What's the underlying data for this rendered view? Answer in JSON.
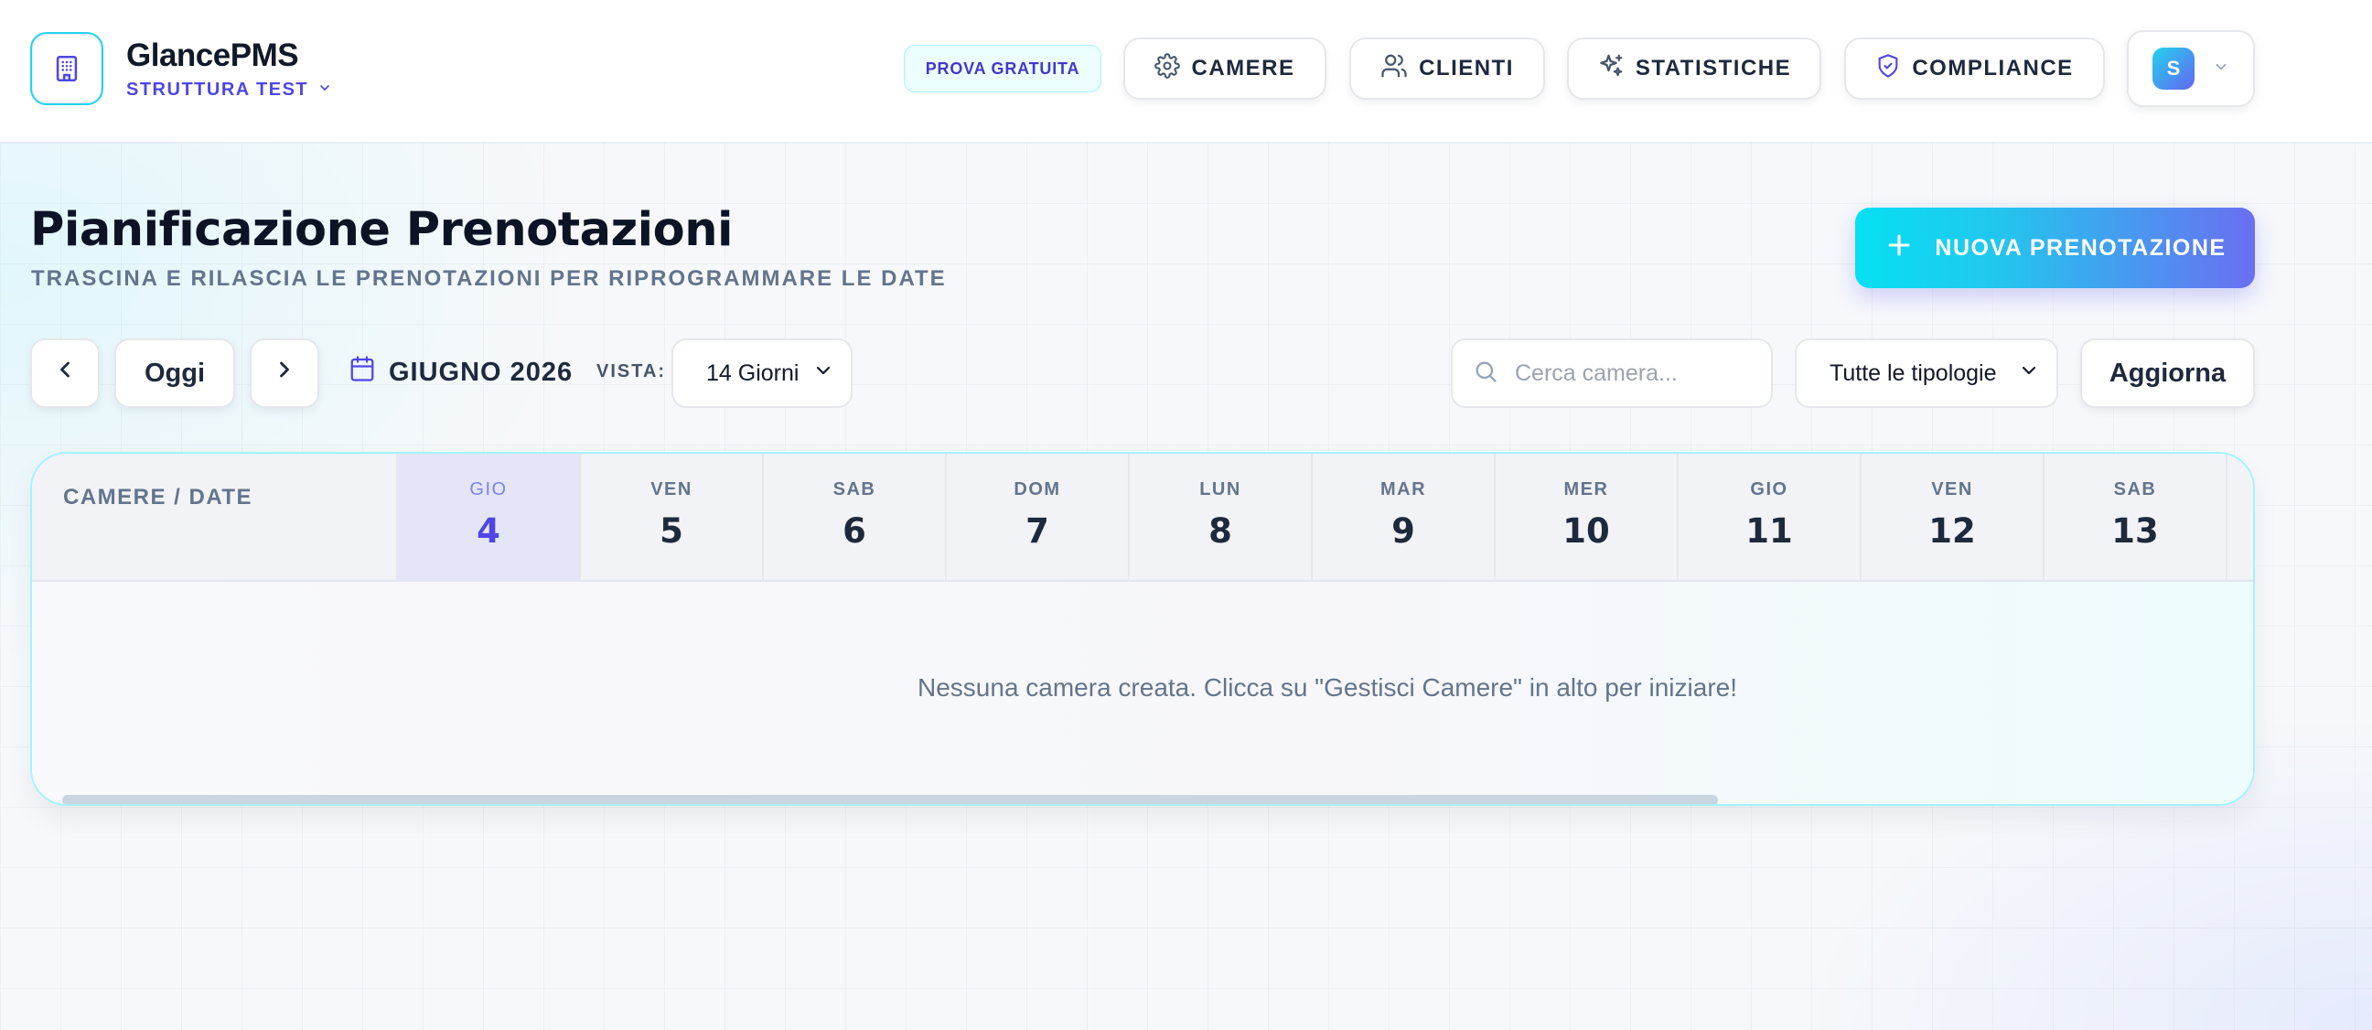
{
  "brand": {
    "name": "GlancePMS",
    "structure": "STRUTTURA TEST"
  },
  "header": {
    "trial_badge": "PROVA GRATUITA",
    "nav": [
      {
        "label": "CAMERE",
        "icon": "gear-icon"
      },
      {
        "label": "CLIENTI",
        "icon": "users-icon"
      },
      {
        "label": "STATISTICHE",
        "icon": "sparkles-icon"
      },
      {
        "label": "COMPLIANCE",
        "icon": "shield-check-icon"
      }
    ],
    "user_initial": "S"
  },
  "page": {
    "title": "Pianificazione Prenotazioni",
    "subtitle": "TRASCINA E RILASCIA LE PRENOTAZIONI PER RIPROGRAMMARE LE DATE",
    "new_booking": "NUOVA PRENOTAZIONE"
  },
  "toolbar": {
    "today": "Oggi",
    "month": "GIUGNO 2026",
    "view_label": "VISTA:",
    "view_value": "14 Giorni",
    "search_placeholder": "Cerca camera...",
    "type_filter": "Tutte le tipologie",
    "refresh": "Aggiorna"
  },
  "calendar": {
    "rooms_header": "CAMERE / DATE",
    "days": [
      {
        "name": "GIO",
        "num": "4",
        "today": true
      },
      {
        "name": "VEN",
        "num": "5"
      },
      {
        "name": "SAB",
        "num": "6"
      },
      {
        "name": "DOM",
        "num": "7"
      },
      {
        "name": "LUN",
        "num": "8"
      },
      {
        "name": "MAR",
        "num": "9"
      },
      {
        "name": "MER",
        "num": "10"
      },
      {
        "name": "GIO",
        "num": "11"
      },
      {
        "name": "VEN",
        "num": "12"
      },
      {
        "name": "SAB",
        "num": "13"
      }
    ],
    "empty_message": "Nessuna camera creata. Clicca su \"Gestisci Camere\" in alto per iniziare!"
  },
  "colors": {
    "accent": "#4f46e5",
    "cyan": "#22d3ee",
    "today_bg": "#e4e5f7"
  }
}
